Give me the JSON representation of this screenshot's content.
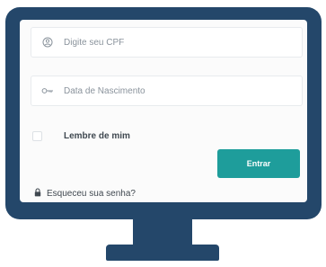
{
  "login_form": {
    "cpf_field": {
      "placeholder": "Digite seu CPF",
      "value": "",
      "icon": "user-icon"
    },
    "birthdate_field": {
      "placeholder": "Data de Nascimento",
      "value": "",
      "icon": "key-icon"
    },
    "remember_me": {
      "label": "Lembre de mim",
      "checked": false
    },
    "submit_label": "Entrar",
    "forgot_password": {
      "label": "Esqueceu sua senha?",
      "icon": "lock-icon"
    }
  },
  "colors": {
    "monitor": "#24476a",
    "accent": "#1e9d9b",
    "screen": "#fbfbfb"
  }
}
